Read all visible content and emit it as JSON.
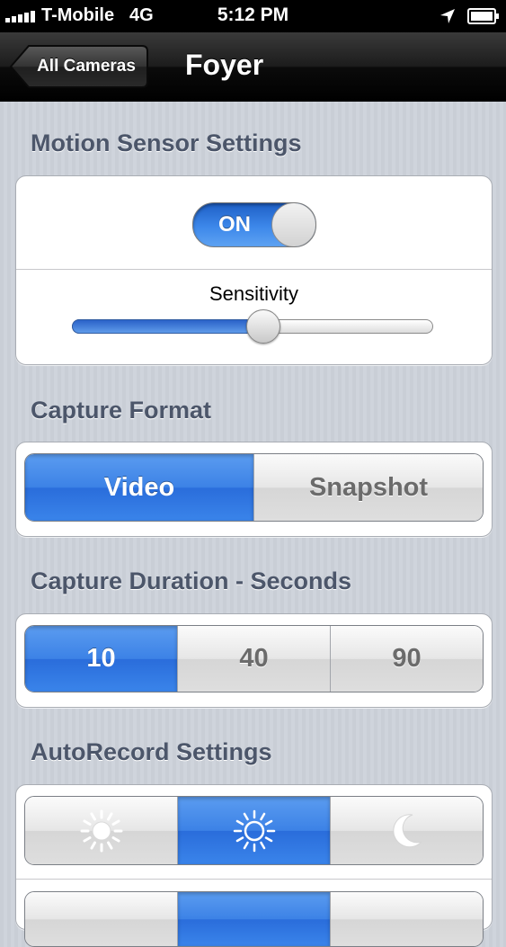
{
  "status_bar": {
    "carrier": "T-Mobile",
    "network": "4G",
    "time": "5:12 PM",
    "signal_bars": 5,
    "icons": [
      "signal-icon",
      "location-arrow-icon",
      "battery-icon"
    ]
  },
  "nav": {
    "back_label": "All Cameras",
    "title": "Foyer"
  },
  "motion": {
    "header": "Motion Sensor Settings",
    "toggle_label": "ON",
    "toggle_on": true,
    "sensitivity_label": "Sensitivity",
    "sensitivity_value": 0.53
  },
  "capture_format": {
    "header": "Capture Format",
    "options": [
      "Video",
      "Snapshot"
    ],
    "selected": 0
  },
  "capture_duration": {
    "header": "Capture Duration - Seconds",
    "options": [
      "10",
      "40",
      "90"
    ],
    "selected": 0
  },
  "autorecord": {
    "header": "AutoRecord Settings",
    "options": [
      "sun-dim-icon",
      "sun-bright-icon",
      "moon-icon"
    ],
    "selected": 1
  },
  "colors": {
    "accent_blue": "#3c82e6",
    "header_text": "#4c566a"
  }
}
